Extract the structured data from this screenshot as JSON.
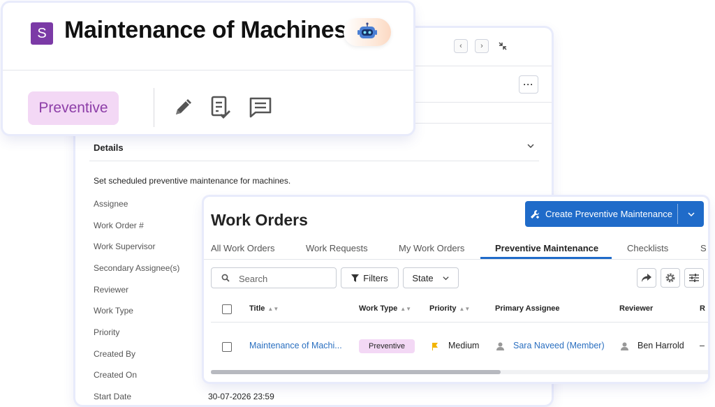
{
  "detail": {
    "nav_prev": "‹",
    "nav_next": "›",
    "more": "···",
    "section_title": "Details",
    "description": "Set scheduled preventive maintenance for machines.",
    "fields": [
      {
        "label": "Assignee",
        "value": ""
      },
      {
        "label": "Work Order #",
        "value": ""
      },
      {
        "label": "Work Supervisor",
        "value": ""
      },
      {
        "label": "Secondary Assignee(s)",
        "value": ""
      },
      {
        "label": "Reviewer",
        "value": ""
      },
      {
        "label": "Work Type",
        "value": ""
      },
      {
        "label": "Priority",
        "value": ""
      },
      {
        "label": "Created By",
        "value": ""
      },
      {
        "label": "Created On",
        "value": ""
      },
      {
        "label": "Start Date",
        "value": "30-07-2026 23:59"
      }
    ]
  },
  "card": {
    "logo_letter": "S",
    "title": "Maintenance of Machines",
    "chip": "Preventive",
    "icons": [
      "pencil-icon",
      "checklist-icon",
      "comment-icon"
    ],
    "bot_icon": "robot-icon"
  },
  "work_orders": {
    "title": "Work Orders",
    "create_label": "Create Preventive Maintenance",
    "tabs": [
      "All Work Orders",
      "Work Requests",
      "My Work Orders",
      "Preventive Maintenance",
      "Checklists",
      "S"
    ],
    "active_tab": "Preventive Maintenance",
    "search_placeholder": "Search",
    "filters_label": "Filters",
    "state_label": "State",
    "columns": [
      "Title",
      "Work Type",
      "Priority",
      "Primary Assignee",
      "Reviewer",
      "R"
    ],
    "rows": [
      {
        "title": "Maintenance of Machi...",
        "work_type": "Preventive",
        "priority": "Medium",
        "primary_assignee": "Sara Naveed (Member)",
        "reviewer": "Ben Harrold",
        "extra": "–"
      }
    ],
    "colors": {
      "accent": "#1f6bc9",
      "chip_bg": "#f3d8f5",
      "chip_text": "#8d3ea8",
      "priority_flag": "#f2b400"
    }
  }
}
